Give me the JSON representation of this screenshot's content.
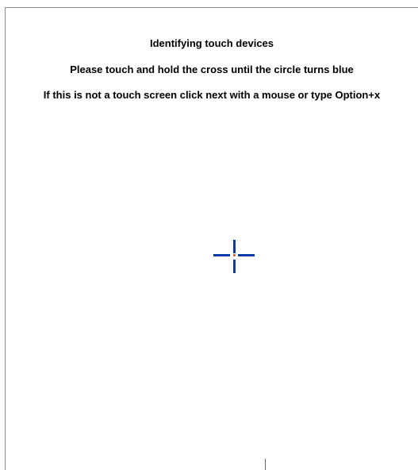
{
  "dialog": {
    "heading": "Identifying touch devices",
    "instruction": "Please touch and hold the cross until  the circle turns blue",
    "alternative": "If this is not a touch screen click next with a mouse or type Option+x"
  },
  "target": {
    "icon": "crosshair-icon",
    "arm_color": "#0a3aa6",
    "center_color": "#e04b1a"
  }
}
